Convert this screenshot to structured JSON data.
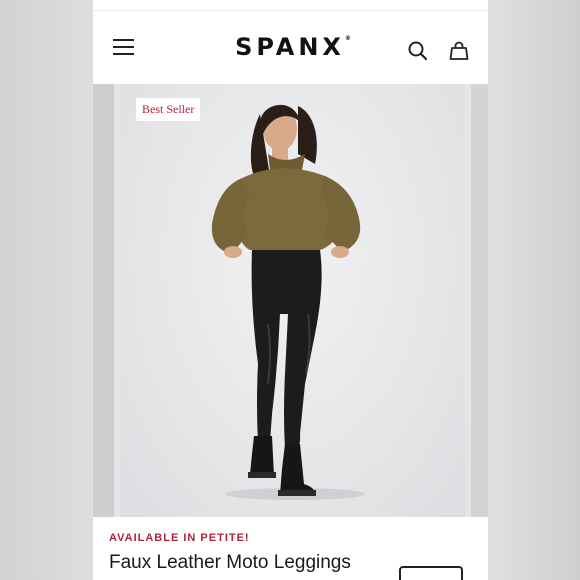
{
  "header": {
    "brand": "SPANX",
    "brand_mark": "®",
    "icons": [
      "menu-icon",
      "search-icon",
      "shopping-bag-icon"
    ]
  },
  "gallery": {
    "badge": "Best Seller"
  },
  "product": {
    "availability": "AVAILABLE IN PETITE!",
    "title": "Faux Leather Moto Leggings"
  },
  "colors": {
    "accent": "#b0243b",
    "text": "#1a1a1a",
    "sweater": "#7d6a3b",
    "leggings": "#1c1c1e",
    "backdrop": "#e4e5e7"
  }
}
